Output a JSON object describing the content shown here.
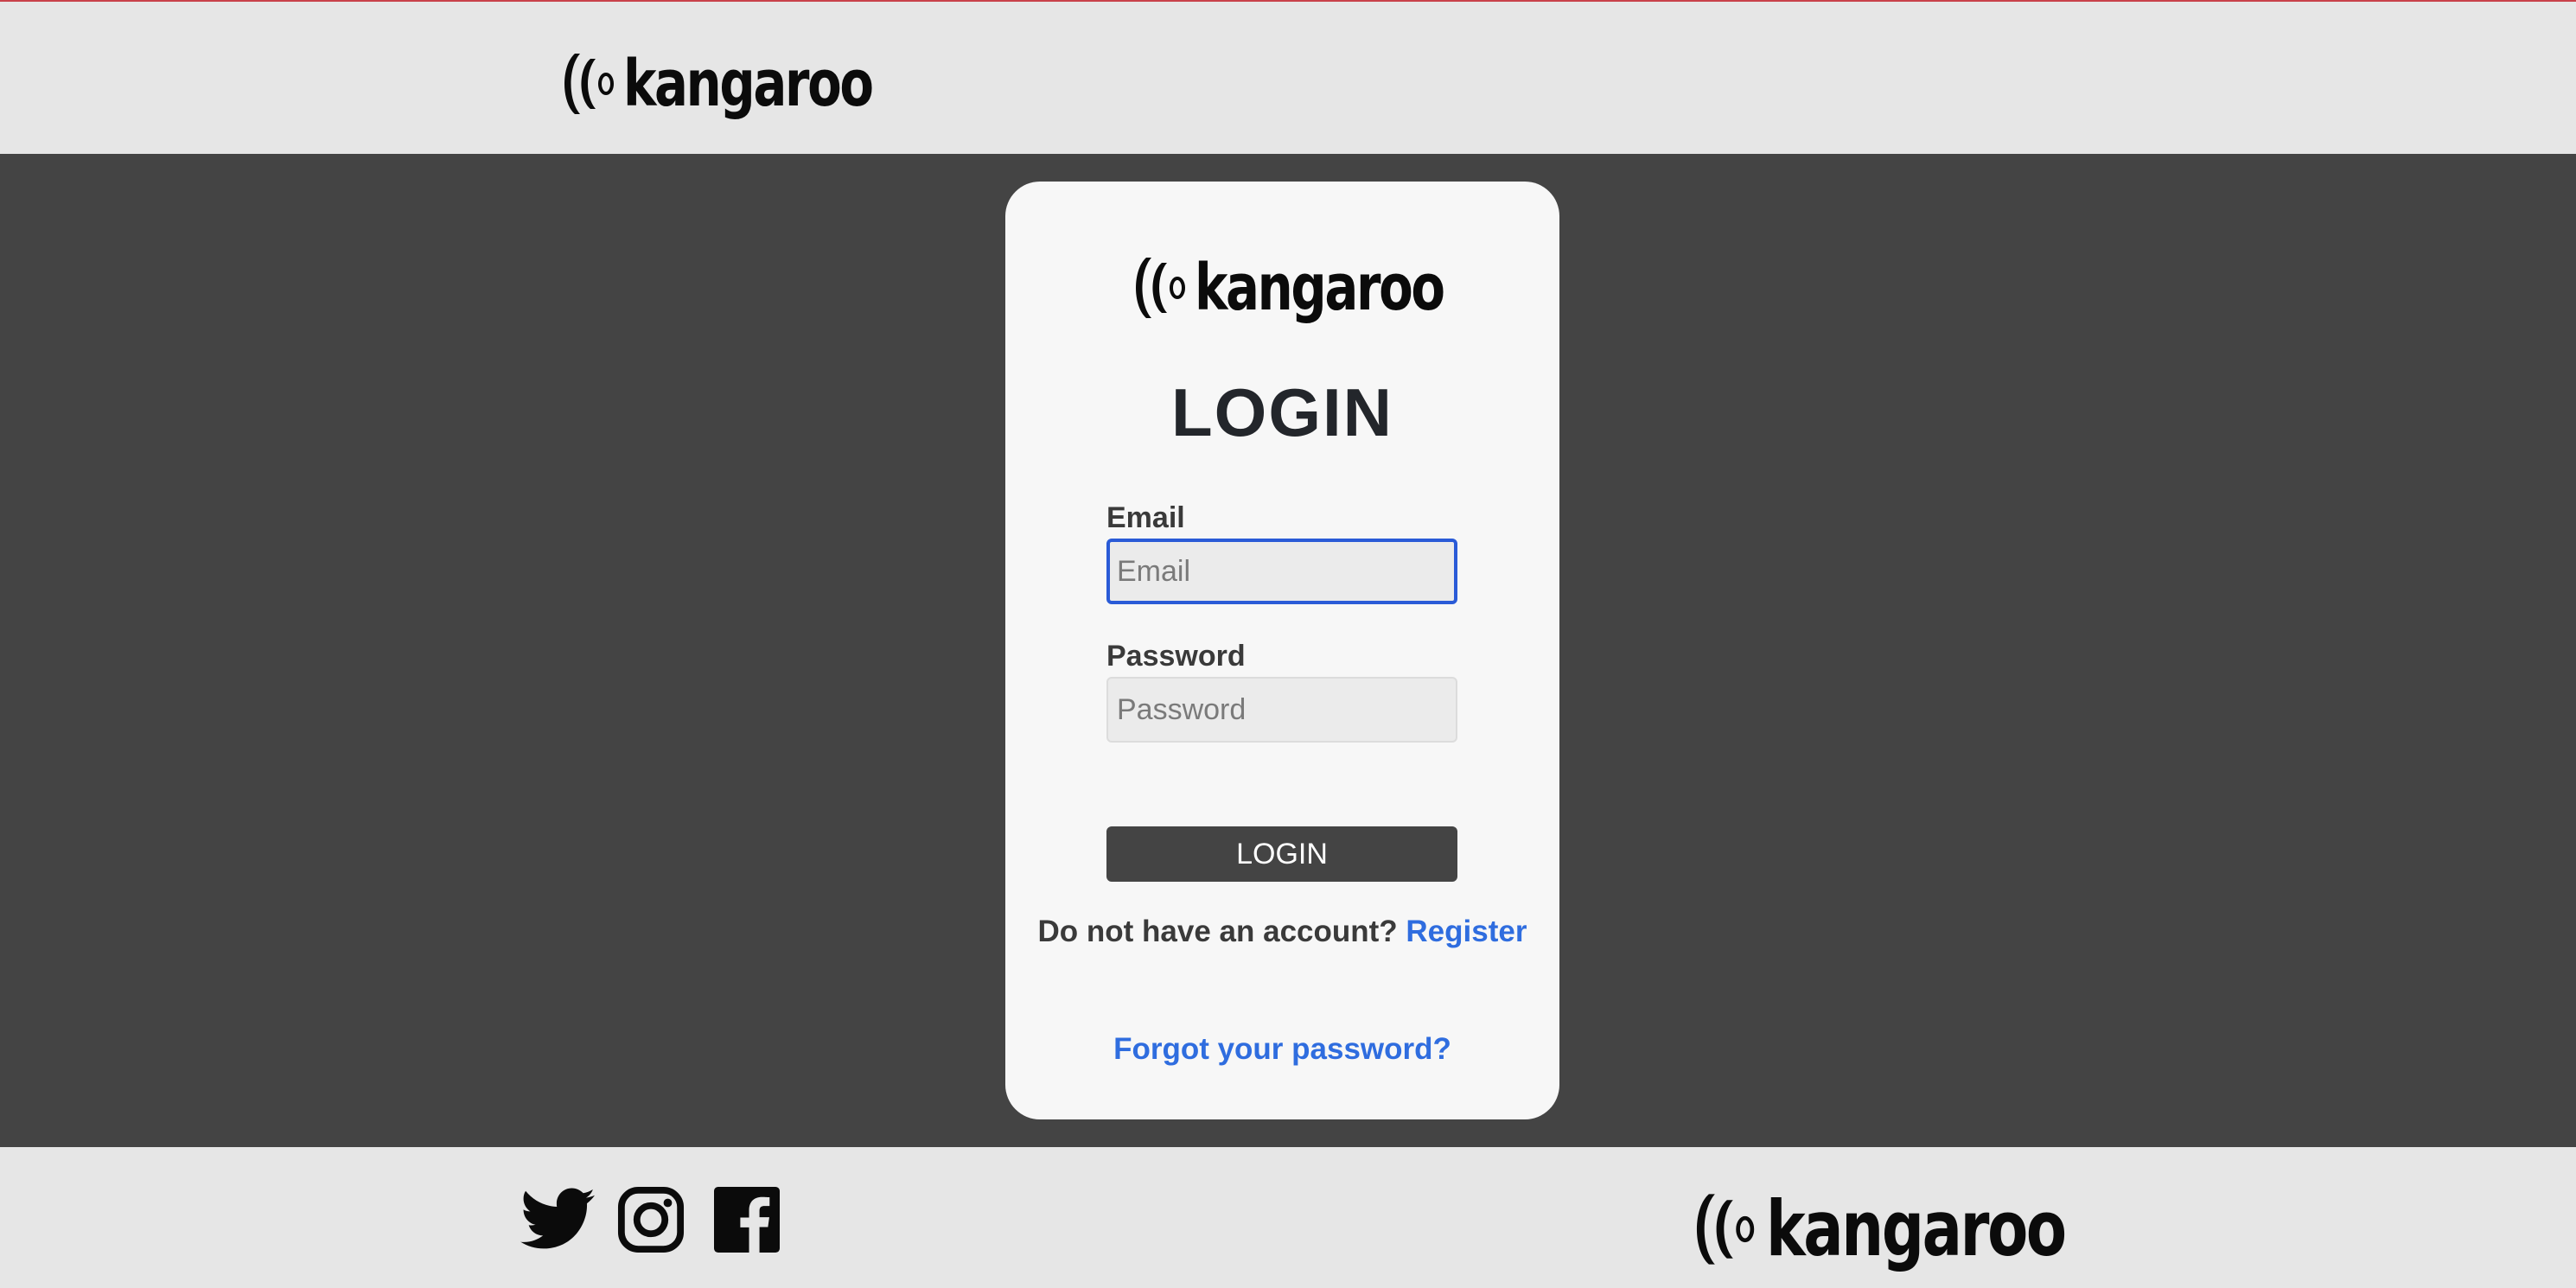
{
  "brand": {
    "name": "kangaroo"
  },
  "login": {
    "title": "LOGIN",
    "email_label": "Email",
    "email_placeholder": "Email",
    "password_label": "Password",
    "password_placeholder": "Password",
    "submit_label": "LOGIN",
    "no_account_text": "Do not have an account?",
    "register_link": "Register",
    "forgot_link": "Forgot your password?"
  },
  "footer": {
    "social": [
      "twitter-icon",
      "instagram-icon",
      "facebook-icon"
    ]
  },
  "colors": {
    "page_bg": "#444444",
    "bar_bg": "#e6e6e6",
    "card_bg": "#f7f7f7",
    "link": "#2f6ddf",
    "focus": "#2a5bd7"
  }
}
